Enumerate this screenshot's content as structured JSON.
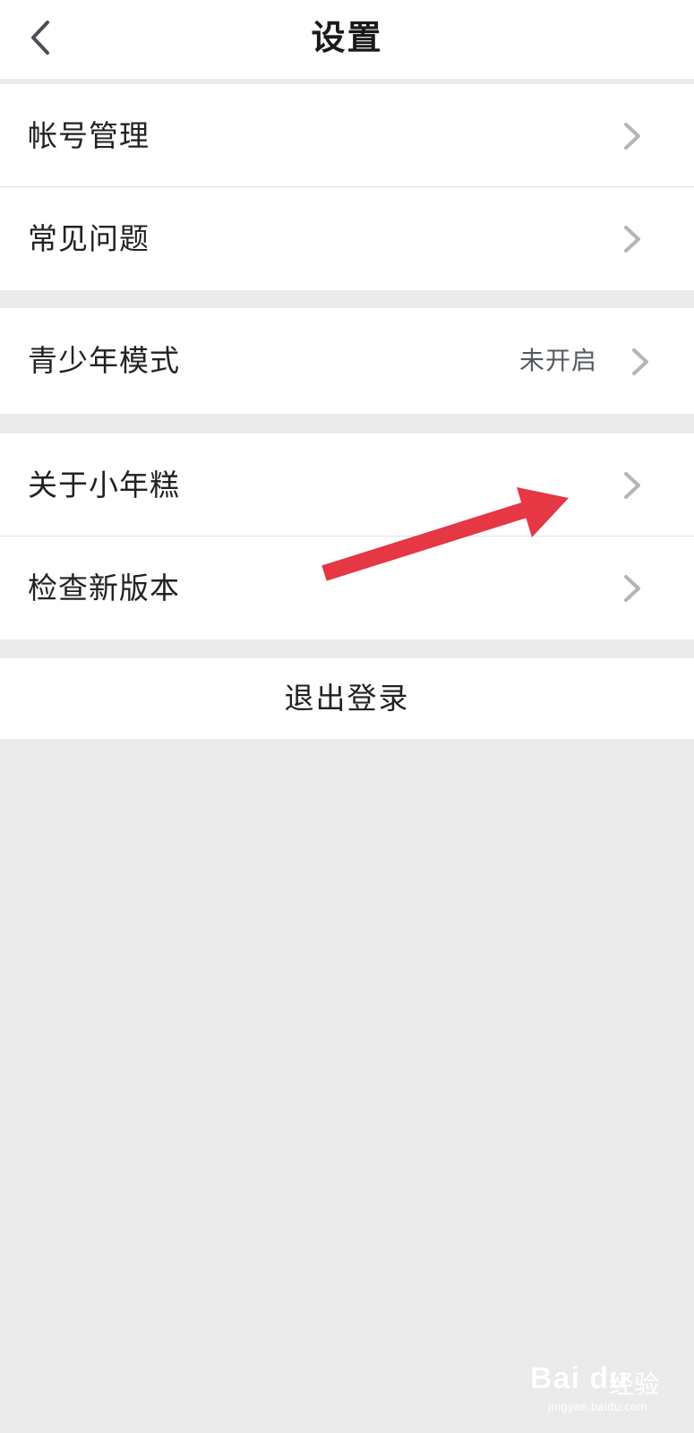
{
  "header": {
    "title": "设置",
    "back_icon": "chevron-left-icon"
  },
  "group1": {
    "items": [
      {
        "label": "帐号管理"
      },
      {
        "label": "常见问题"
      }
    ]
  },
  "group2": {
    "items": [
      {
        "label": "青少年模式",
        "value": "未开启"
      }
    ]
  },
  "group3": {
    "items": [
      {
        "label": "关于小年糕"
      },
      {
        "label": "检查新版本"
      }
    ]
  },
  "logout": {
    "label": "退出登录"
  },
  "annotation": {
    "color": "#e53744"
  },
  "watermark": {
    "brand": "Bai du",
    "label": "经验",
    "url": "jingyan.baidu.com"
  },
  "colors": {
    "background": "#ebebeb",
    "card": "#ffffff",
    "chevron": "#b5b5b5",
    "text": "#222222"
  }
}
